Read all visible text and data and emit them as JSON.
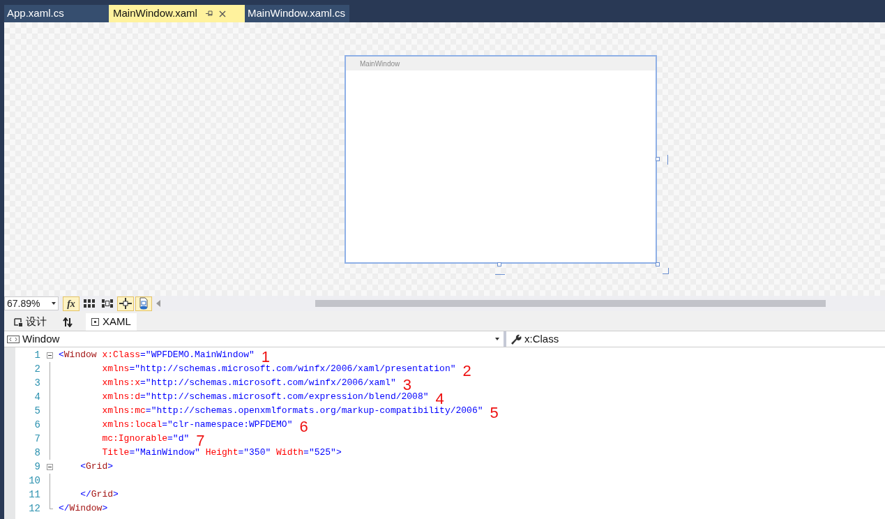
{
  "doc_tabs": [
    {
      "label": "App.xaml.cs",
      "selected": false
    },
    {
      "label": "MainWindow.xaml",
      "selected": true
    },
    {
      "label": "MainWindow.xaml.cs",
      "selected": false
    }
  ],
  "designer": {
    "preview_window": {
      "title": "MainWindow"
    }
  },
  "toolbar": {
    "zoom": "67.89%",
    "buttons": [
      {
        "kind": "fx",
        "label": "fx",
        "on": true
      },
      {
        "kind": "grid",
        "on": false
      },
      {
        "kind": "snap-grid",
        "on": false
      },
      {
        "kind": "snap-lines",
        "on": true
      },
      {
        "kind": "artboard",
        "on": true
      }
    ]
  },
  "view_tabs": [
    {
      "kind": "design",
      "label": "设计",
      "selected": false
    },
    {
      "kind": "swap"
    },
    {
      "kind": "xaml",
      "label": "XAML",
      "selected": true
    }
  ],
  "element_dropdown": {
    "value": "Window"
  },
  "member_dropdown": {
    "value": "x:Class"
  },
  "code_lines": [
    {
      "number": "1",
      "fold": true,
      "tokens": [
        {
          "kind": "punct",
          "text": "<"
        },
        {
          "kind": "element",
          "text": "Window "
        },
        {
          "kind": "attr",
          "text": "x:Class"
        },
        {
          "kind": "punct",
          "text": "=\"WPFDEMO.MainWindow\""
        }
      ],
      "annotation": "1"
    },
    {
      "number": "2",
      "fold": false,
      "tokens": [
        {
          "kind": "attr",
          "text": "        xmlns"
        },
        {
          "kind": "punct",
          "text": "=\"http://schemas.microsoft.com/winfx/2006/xaml/presentation\""
        }
      ],
      "annotation": "2"
    },
    {
      "number": "3",
      "fold": false,
      "tokens": [
        {
          "kind": "attr",
          "text": "        xmlns:x"
        },
        {
          "kind": "punct",
          "text": "=\"http://schemas.microsoft.com/winfx/2006/xaml\""
        }
      ],
      "annotation": "3"
    },
    {
      "number": "4",
      "fold": false,
      "tokens": [
        {
          "kind": "attr",
          "text": "        xmlns:d"
        },
        {
          "kind": "punct",
          "text": "=\"http://schemas.microsoft.com/expression/blend/2008\""
        }
      ],
      "annotation": "4"
    },
    {
      "number": "5",
      "fold": false,
      "tokens": [
        {
          "kind": "attr",
          "text": "        xmlns:mc"
        },
        {
          "kind": "punct",
          "text": "=\"http://schemas.openxmlformats.org/markup-compatibility/2006\""
        }
      ],
      "annotation": "5"
    },
    {
      "number": "6",
      "fold": false,
      "tokens": [
        {
          "kind": "attr",
          "text": "        xmlns:local"
        },
        {
          "kind": "punct",
          "text": "=\"clr-namespace:WPFDEMO\""
        }
      ],
      "annotation": "6"
    },
    {
      "number": "7",
      "fold": false,
      "tokens": [
        {
          "kind": "attr",
          "text": "        mc:Ignorable"
        },
        {
          "kind": "punct",
          "text": "=\"d\""
        }
      ],
      "annotation": "7"
    },
    {
      "number": "8",
      "fold": false,
      "tokens": [
        {
          "kind": "attr",
          "text": "        Title"
        },
        {
          "kind": "punct",
          "text": "=\"MainWindow\" "
        },
        {
          "kind": "attr",
          "text": "Height"
        },
        {
          "kind": "punct",
          "text": "=\"350\" "
        },
        {
          "kind": "attr",
          "text": "Width"
        },
        {
          "kind": "punct",
          "text": "=\"525\">"
        }
      ]
    },
    {
      "number": "9",
      "fold": true,
      "tokens": [
        {
          "kind": "punct",
          "text": "    <"
        },
        {
          "kind": "element",
          "text": "Grid"
        },
        {
          "kind": "punct",
          "text": ">"
        }
      ]
    },
    {
      "number": "10",
      "fold": false
    },
    {
      "number": "11",
      "fold": false,
      "tokens": [
        {
          "kind": "punct",
          "text": "    </"
        },
        {
          "kind": "element",
          "text": "Grid"
        },
        {
          "kind": "punct",
          "text": ">"
        }
      ]
    },
    {
      "number": "12",
      "fold": false,
      "tokens": [
        {
          "kind": "punct",
          "text": "</"
        },
        {
          "kind": "element",
          "text": "Window"
        },
        {
          "kind": "punct",
          "text": ">"
        }
      ]
    }
  ]
}
